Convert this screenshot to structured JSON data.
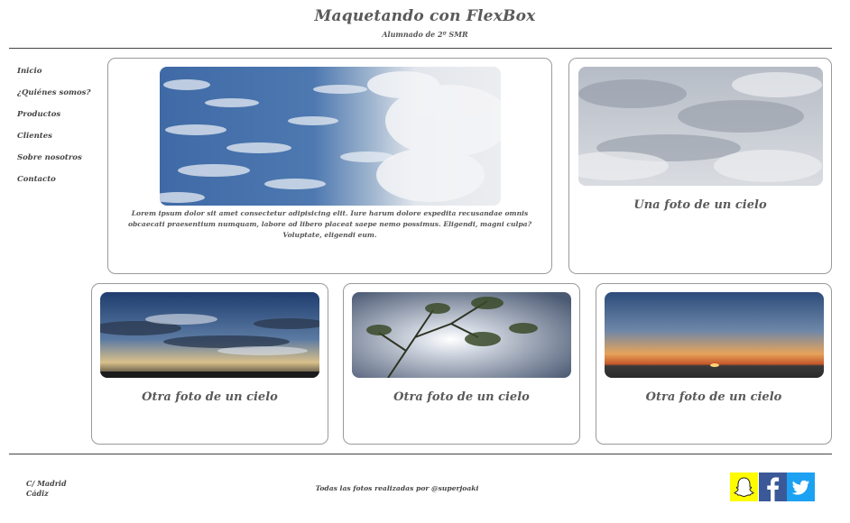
{
  "header": {
    "title": "Maquetando con FlexBox",
    "subtitle": "Alumnado de 2º SMR"
  },
  "nav": {
    "items": [
      {
        "label": "Inicio"
      },
      {
        "label": "¿Quiénes somos?"
      },
      {
        "label": "Productos"
      },
      {
        "label": "Clientes"
      },
      {
        "label": "Sobre nosotros"
      },
      {
        "label": "Contacto"
      }
    ]
  },
  "cards": [
    {
      "text": "Lorem ipsum dolor sit amet consectetur adipisicing elit. Iure harum dolore expedita recusandae omnis obcaecati praesentium numquam, labore ad libero placeat saepe nemo possimus. Eligendi, magni culpa? Voluptate, eligendi eum."
    },
    {
      "caption": "Una foto de un cielo"
    },
    {
      "caption": "Otra foto de un cielo"
    },
    {
      "caption": "Otra foto de un cielo"
    },
    {
      "caption": "Otra foto de un cielo"
    }
  ],
  "footer": {
    "address_line1": "C/ Madrid",
    "address_line2": "Cádiz",
    "credit": "Todas las fotos realizadas por @superjoaki",
    "social": [
      {
        "icon": "snapchat-icon",
        "color": "#fffc00"
      },
      {
        "icon": "facebook-icon",
        "color": "#3b5998"
      },
      {
        "icon": "twitter-icon",
        "color": "#1da1f2"
      }
    ]
  }
}
